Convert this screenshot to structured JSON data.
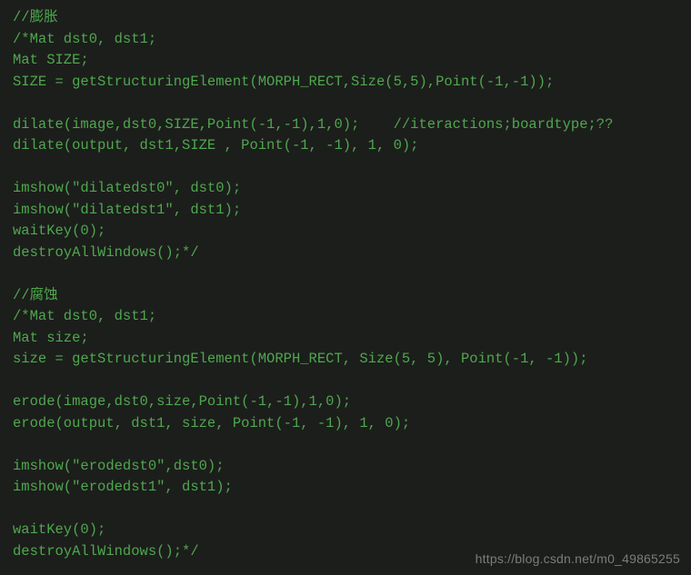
{
  "code": {
    "l01": "//膨胀",
    "l02": "/*Mat dst0, dst1;",
    "l03": "Mat SIZE;",
    "l04": "SIZE = getStructuringElement(MORPH_RECT,Size(5,5),Point(-1,-1));",
    "l05": "",
    "l06": "dilate(image,dst0,SIZE,Point(-1,-1),1,0);    //iteractions;boardtype;??",
    "l07": "dilate(output, dst1,SIZE , Point(-1, -1), 1, 0);",
    "l08": "",
    "l09": "imshow(\"dilatedst0\", dst0);",
    "l10": "imshow(\"dilatedst1\", dst1);",
    "l11": "waitKey(0);",
    "l12": "destroyAllWindows();*/",
    "l13": "",
    "l14": "//腐蚀",
    "l15": "/*Mat dst0, dst1;",
    "l16": "Mat size;",
    "l17": "size = getStructuringElement(MORPH_RECT, Size(5, 5), Point(-1, -1));",
    "l18": "",
    "l19": "erode(image,dst0,size,Point(-1,-1),1,0);",
    "l20": "erode(output, dst1, size, Point(-1, -1), 1, 0);",
    "l21": "",
    "l22": "imshow(\"erodedst0\",dst0);",
    "l23": "imshow(\"erodedst1\", dst1);",
    "l24": "",
    "l25": "waitKey(0);",
    "l26": "destroyAllWindows();*/"
  },
  "watermark": "https://blog.csdn.net/m0_49865255"
}
